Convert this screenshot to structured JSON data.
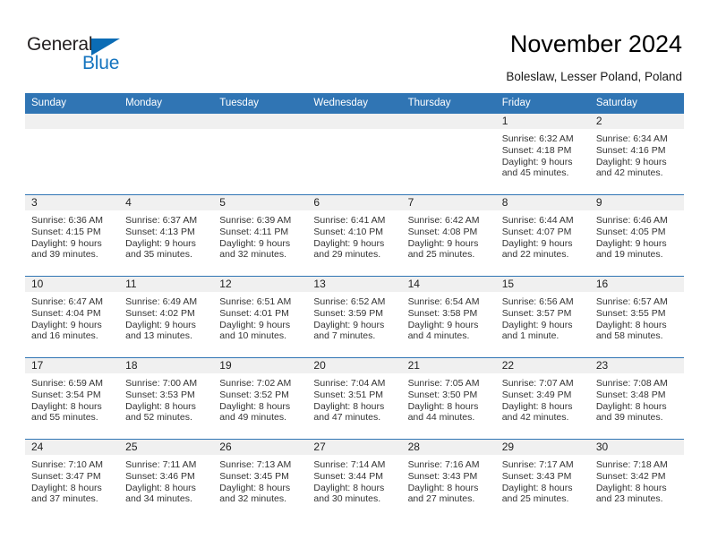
{
  "brand": {
    "name_part1": "General",
    "name_part2": "Blue",
    "triangle_color": "#0b6cb5",
    "blue_color": "#1574bf"
  },
  "header": {
    "title": "November 2024",
    "subtitle": "Boleslaw, Lesser Poland, Poland"
  },
  "theme": {
    "header_blue": "#3075b4",
    "daynum_gray": "#f0f0f0"
  },
  "weekday_headers": [
    "Sunday",
    "Monday",
    "Tuesday",
    "Wednesday",
    "Thursday",
    "Friday",
    "Saturday"
  ],
  "weeks": [
    [
      {
        "day": "",
        "sunrise": "",
        "sunset": "",
        "daylight1": "",
        "daylight2": ""
      },
      {
        "day": "",
        "sunrise": "",
        "sunset": "",
        "daylight1": "",
        "daylight2": ""
      },
      {
        "day": "",
        "sunrise": "",
        "sunset": "",
        "daylight1": "",
        "daylight2": ""
      },
      {
        "day": "",
        "sunrise": "",
        "sunset": "",
        "daylight1": "",
        "daylight2": ""
      },
      {
        "day": "",
        "sunrise": "",
        "sunset": "",
        "daylight1": "",
        "daylight2": ""
      },
      {
        "day": "1",
        "sunrise": "Sunrise: 6:32 AM",
        "sunset": "Sunset: 4:18 PM",
        "daylight1": "Daylight: 9 hours",
        "daylight2": "and 45 minutes."
      },
      {
        "day": "2",
        "sunrise": "Sunrise: 6:34 AM",
        "sunset": "Sunset: 4:16 PM",
        "daylight1": "Daylight: 9 hours",
        "daylight2": "and 42 minutes."
      }
    ],
    [
      {
        "day": "3",
        "sunrise": "Sunrise: 6:36 AM",
        "sunset": "Sunset: 4:15 PM",
        "daylight1": "Daylight: 9 hours",
        "daylight2": "and 39 minutes."
      },
      {
        "day": "4",
        "sunrise": "Sunrise: 6:37 AM",
        "sunset": "Sunset: 4:13 PM",
        "daylight1": "Daylight: 9 hours",
        "daylight2": "and 35 minutes."
      },
      {
        "day": "5",
        "sunrise": "Sunrise: 6:39 AM",
        "sunset": "Sunset: 4:11 PM",
        "daylight1": "Daylight: 9 hours",
        "daylight2": "and 32 minutes."
      },
      {
        "day": "6",
        "sunrise": "Sunrise: 6:41 AM",
        "sunset": "Sunset: 4:10 PM",
        "daylight1": "Daylight: 9 hours",
        "daylight2": "and 29 minutes."
      },
      {
        "day": "7",
        "sunrise": "Sunrise: 6:42 AM",
        "sunset": "Sunset: 4:08 PM",
        "daylight1": "Daylight: 9 hours",
        "daylight2": "and 25 minutes."
      },
      {
        "day": "8",
        "sunrise": "Sunrise: 6:44 AM",
        "sunset": "Sunset: 4:07 PM",
        "daylight1": "Daylight: 9 hours",
        "daylight2": "and 22 minutes."
      },
      {
        "day": "9",
        "sunrise": "Sunrise: 6:46 AM",
        "sunset": "Sunset: 4:05 PM",
        "daylight1": "Daylight: 9 hours",
        "daylight2": "and 19 minutes."
      }
    ],
    [
      {
        "day": "10",
        "sunrise": "Sunrise: 6:47 AM",
        "sunset": "Sunset: 4:04 PM",
        "daylight1": "Daylight: 9 hours",
        "daylight2": "and 16 minutes."
      },
      {
        "day": "11",
        "sunrise": "Sunrise: 6:49 AM",
        "sunset": "Sunset: 4:02 PM",
        "daylight1": "Daylight: 9 hours",
        "daylight2": "and 13 minutes."
      },
      {
        "day": "12",
        "sunrise": "Sunrise: 6:51 AM",
        "sunset": "Sunset: 4:01 PM",
        "daylight1": "Daylight: 9 hours",
        "daylight2": "and 10 minutes."
      },
      {
        "day": "13",
        "sunrise": "Sunrise: 6:52 AM",
        "sunset": "Sunset: 3:59 PM",
        "daylight1": "Daylight: 9 hours",
        "daylight2": "and 7 minutes."
      },
      {
        "day": "14",
        "sunrise": "Sunrise: 6:54 AM",
        "sunset": "Sunset: 3:58 PM",
        "daylight1": "Daylight: 9 hours",
        "daylight2": "and 4 minutes."
      },
      {
        "day": "15",
        "sunrise": "Sunrise: 6:56 AM",
        "sunset": "Sunset: 3:57 PM",
        "daylight1": "Daylight: 9 hours",
        "daylight2": "and 1 minute."
      },
      {
        "day": "16",
        "sunrise": "Sunrise: 6:57 AM",
        "sunset": "Sunset: 3:55 PM",
        "daylight1": "Daylight: 8 hours",
        "daylight2": "and 58 minutes."
      }
    ],
    [
      {
        "day": "17",
        "sunrise": "Sunrise: 6:59 AM",
        "sunset": "Sunset: 3:54 PM",
        "daylight1": "Daylight: 8 hours",
        "daylight2": "and 55 minutes."
      },
      {
        "day": "18",
        "sunrise": "Sunrise: 7:00 AM",
        "sunset": "Sunset: 3:53 PM",
        "daylight1": "Daylight: 8 hours",
        "daylight2": "and 52 minutes."
      },
      {
        "day": "19",
        "sunrise": "Sunrise: 7:02 AM",
        "sunset": "Sunset: 3:52 PM",
        "daylight1": "Daylight: 8 hours",
        "daylight2": "and 49 minutes."
      },
      {
        "day": "20",
        "sunrise": "Sunrise: 7:04 AM",
        "sunset": "Sunset: 3:51 PM",
        "daylight1": "Daylight: 8 hours",
        "daylight2": "and 47 minutes."
      },
      {
        "day": "21",
        "sunrise": "Sunrise: 7:05 AM",
        "sunset": "Sunset: 3:50 PM",
        "daylight1": "Daylight: 8 hours",
        "daylight2": "and 44 minutes."
      },
      {
        "day": "22",
        "sunrise": "Sunrise: 7:07 AM",
        "sunset": "Sunset: 3:49 PM",
        "daylight1": "Daylight: 8 hours",
        "daylight2": "and 42 minutes."
      },
      {
        "day": "23",
        "sunrise": "Sunrise: 7:08 AM",
        "sunset": "Sunset: 3:48 PM",
        "daylight1": "Daylight: 8 hours",
        "daylight2": "and 39 minutes."
      }
    ],
    [
      {
        "day": "24",
        "sunrise": "Sunrise: 7:10 AM",
        "sunset": "Sunset: 3:47 PM",
        "daylight1": "Daylight: 8 hours",
        "daylight2": "and 37 minutes."
      },
      {
        "day": "25",
        "sunrise": "Sunrise: 7:11 AM",
        "sunset": "Sunset: 3:46 PM",
        "daylight1": "Daylight: 8 hours",
        "daylight2": "and 34 minutes."
      },
      {
        "day": "26",
        "sunrise": "Sunrise: 7:13 AM",
        "sunset": "Sunset: 3:45 PM",
        "daylight1": "Daylight: 8 hours",
        "daylight2": "and 32 minutes."
      },
      {
        "day": "27",
        "sunrise": "Sunrise: 7:14 AM",
        "sunset": "Sunset: 3:44 PM",
        "daylight1": "Daylight: 8 hours",
        "daylight2": "and 30 minutes."
      },
      {
        "day": "28",
        "sunrise": "Sunrise: 7:16 AM",
        "sunset": "Sunset: 3:43 PM",
        "daylight1": "Daylight: 8 hours",
        "daylight2": "and 27 minutes."
      },
      {
        "day": "29",
        "sunrise": "Sunrise: 7:17 AM",
        "sunset": "Sunset: 3:43 PM",
        "daylight1": "Daylight: 8 hours",
        "daylight2": "and 25 minutes."
      },
      {
        "day": "30",
        "sunrise": "Sunrise: 7:18 AM",
        "sunset": "Sunset: 3:42 PM",
        "daylight1": "Daylight: 8 hours",
        "daylight2": "and 23 minutes."
      }
    ]
  ]
}
